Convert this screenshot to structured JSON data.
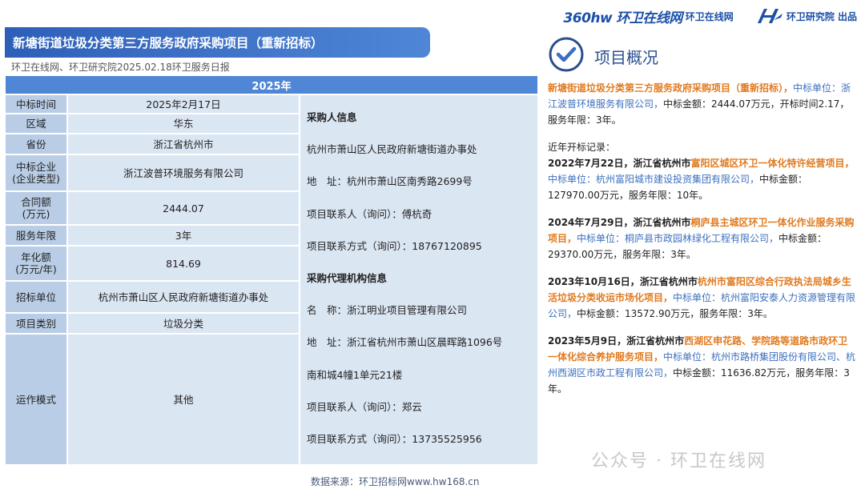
{
  "logos": {
    "hw360_main": "360hw",
    "hw360_sub": "环卫在线网",
    "hw360_name": "环卫在线网",
    "hwyjy_name": "环卫研究院 出品"
  },
  "title": "新塘街道垃圾分类第三方服务政府采购项目（重新招标）",
  "source_line": "环卫在线网、环卫研究院2025.02.18环卫服务日报",
  "table": {
    "year": "2025年",
    "rows": [
      {
        "key": "中标时间",
        "value": "2025年2月17日"
      },
      {
        "key": "区域",
        "value": "华东"
      },
      {
        "key": "省份",
        "value": "浙江省杭州市"
      },
      {
        "key": "中标企业\n(企业类型)",
        "value": "浙江波普环境服务有限公司"
      },
      {
        "key": "合同额\n(万元)",
        "value": "2444.07"
      },
      {
        "key": "服务年限",
        "value": "3年"
      },
      {
        "key": "年化额\n(万元/年)",
        "value": "814.69"
      },
      {
        "key": "招标单位",
        "value": "杭州市萧山区人民政府新塘街道办事处"
      },
      {
        "key": "项目类别",
        "value": "垃圾分类"
      },
      {
        "key": "运作模式",
        "value": "其他"
      }
    ],
    "info_lines": [
      {
        "text": "采购人信息",
        "head": true
      },
      {
        "text": "杭州市萧山区人民政府新塘街道办事处",
        "head": false
      },
      {
        "text": "地　址：杭州市萧山区南秀路2699号",
        "head": false
      },
      {
        "text": "项目联系人（询问）：傅杭奇",
        "head": false
      },
      {
        "text": "项目联系方式（询问）：18767120895",
        "head": false
      },
      {
        "text": "采购代理机构信息",
        "head": true
      },
      {
        "text": "名　称：浙江明业项目管理有限公司",
        "head": false
      },
      {
        "text": "地　址：浙江省杭州市萧山区晨晖路1096号",
        "head": false
      },
      {
        "text": "南和城4幢1单元21楼",
        "head": false
      },
      {
        "text": "项目联系人（询问）：郑云",
        "head": false
      },
      {
        "text": "项目联系方式（询问）：13735525956",
        "head": false
      }
    ]
  },
  "footer_source": "数据来源：环卫招标网www.hw168.cn",
  "overview": {
    "title": "项目概况",
    "summary": {
      "project": "新塘街道垃圾分类第三方服务政府采购项目（重新招标），",
      "rest": "中标单位：浙江波普环境服务有限公司，",
      "amount": "中标金额：2444.07万元，开标时间2.17，服务年限：3年。"
    },
    "recent_label": "近年开标记录：",
    "records": [
      {
        "date": "2022年7月22日，",
        "region": "浙江省杭州市",
        "project": "富阳区城区环卫一体化特许经营项目，",
        "winner": "中标单位：杭州富阳城市建设投资集团有限公司，",
        "amount": "中标金额：127970.00万元，服务年限：10年。"
      },
      {
        "date": "2024年7月29日，",
        "region": "浙江省杭州市",
        "project": "桐庐县主城区环卫一体化作业服务采购项目，",
        "winner": "中标单位：桐庐县市政园林绿化工程有限公司，",
        "amount": "中标金额：29370.00万元，服务年限：3年。"
      },
      {
        "date": "2023年10月16日，",
        "region": "浙江省杭州市",
        "project": "杭州市富阳区综合行政执法局城乡生活垃圾分类收运市场化项目，",
        "winner": "中标单位：杭州富阳安泰人力资源管理有限公司，",
        "amount": "中标金额：13572.90万元，服务年限：3年。"
      },
      {
        "date": "2023年5月9日，",
        "region": "浙江省杭州市",
        "project": "西湖区申花路、学院路等道路市政环卫一体化综合养护服务项目，",
        "winner": "中标单位：杭州市路桥集团股份有限公司、杭州西湖区市政工程有限公司，",
        "amount": "中标金额：11636.82万元，服务年限：3年。"
      }
    ]
  },
  "watermark": "公众号 · 环卫在线网",
  "colors": {
    "banner": "#2e5fb8",
    "header": "#4f86d6",
    "key_cell": "#b9cde6",
    "value_cell": "#dbe6f3",
    "orange": "#e07a1f",
    "blue_text": "#3c6fbf"
  }
}
